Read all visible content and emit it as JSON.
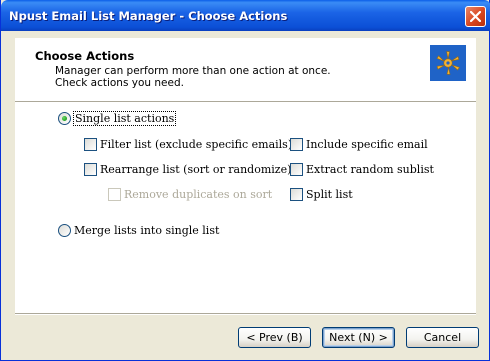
{
  "window": {
    "title": "Npust Email List Manager - Choose Actions"
  },
  "header": {
    "title": "Choose Actions",
    "line1": "Manager can perform more than one action at once.",
    "line2": "Check actions you need."
  },
  "options": {
    "single_list_actions": {
      "label": "Single list actions",
      "selected": true
    },
    "filter_list": {
      "label": "Filter list (exclude specific emails)",
      "checked": false
    },
    "include_specific_email": {
      "label": "Include specific email",
      "checked": false
    },
    "rearrange_list": {
      "label": "Rearrange list (sort or randomize)",
      "checked": false
    },
    "extract_random_sublist": {
      "label": "Extract random sublist",
      "checked": false
    },
    "remove_duplicates": {
      "label": "Remove duplicates on sort",
      "checked": false,
      "enabled": false
    },
    "split_list": {
      "label": "Split list",
      "checked": false
    },
    "merge_lists": {
      "label": "Merge lists into single list",
      "selected": false
    }
  },
  "buttons": {
    "prev": "< Prev (B)",
    "next": "Next (N) >",
    "cancel": "Cancel"
  },
  "colors": {
    "titlebar": "#0b4fd6",
    "dialog_bg": "#ece9d8",
    "logo_bg": "#1f63c7",
    "logo_glyph": "#f3b233"
  },
  "icons": {
    "close": "close-icon",
    "logo": "app-logo-icon"
  }
}
